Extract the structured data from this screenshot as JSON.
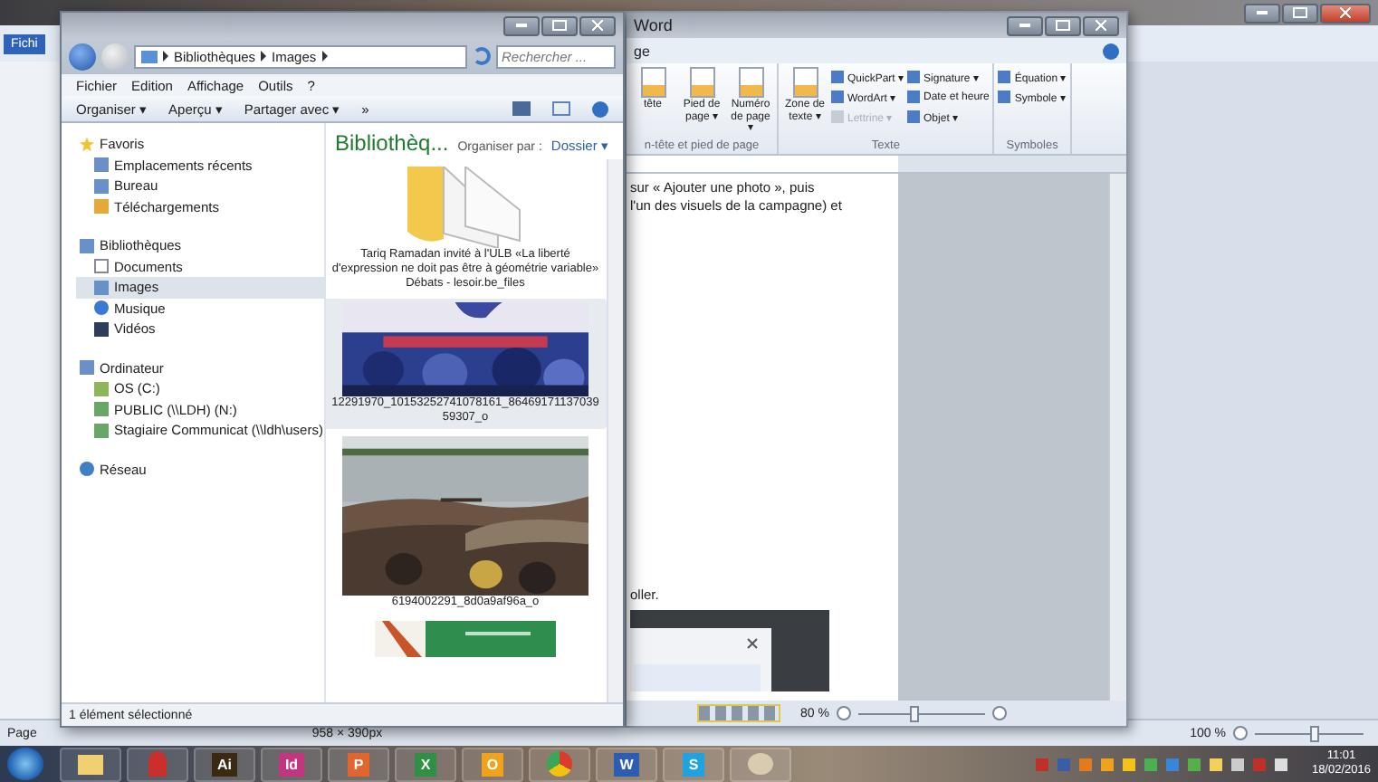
{
  "back_window": {
    "tab": "Fichi",
    "page_label": "Page",
    "size_label": "958 × 390px",
    "zoom": {
      "reading": "100 %",
      "level": 0.55
    }
  },
  "word_window": {
    "title": "Word",
    "tab_fragment": "ge",
    "groups": [
      {
        "label": "n-tête et pied de page",
        "large": [
          "tête",
          "Pied de page ▾",
          "Numéro de page ▾"
        ]
      },
      {
        "label": "Texte",
        "large": [
          "Zone de texte ▾"
        ],
        "small": [
          {
            "label": "QuickPart ▾",
            "disabled": false
          },
          {
            "label": "WordArt ▾",
            "disabled": false
          },
          {
            "label": "Lettrine ▾",
            "disabled": true
          },
          {
            "label": "Signature ▾",
            "disabled": false
          },
          {
            "label": "Date et heure",
            "disabled": false
          },
          {
            "label": "Objet ▾",
            "disabled": false
          }
        ]
      },
      {
        "label": "Symboles",
        "small": [
          {
            "label": "Équation ▾",
            "disabled": false
          },
          {
            "label": "Symbole ▾",
            "disabled": false
          }
        ]
      }
    ],
    "doc_lines": [
      "sur « Ajouter une photo », puis",
      "l'un des visuels de la campagne) et"
    ],
    "doc_fragment": "oller.",
    "zoom": {
      "reading": "80 %",
      "level": 0.45
    }
  },
  "explorer": {
    "address": [
      "Bibliothèques",
      "Images"
    ],
    "search": {
      "placeholder": "Rechercher ..."
    },
    "menu": [
      "Fichier",
      "Edition",
      "Affichage",
      "Outils",
      "?"
    ],
    "toolbar": [
      "Organiser ▾",
      "Aperçu ▾",
      "Partager avec ▾",
      "»"
    ],
    "nav": [
      {
        "label": "Favoris",
        "kind": "star",
        "selected": false,
        "children": [
          {
            "label": "Emplacements récents",
            "kind": "recent",
            "selected": false
          },
          {
            "label": "Bureau",
            "kind": "desktop",
            "selected": false
          },
          {
            "label": "Téléchargements",
            "kind": "download",
            "selected": false
          }
        ]
      },
      {
        "label": "Bibliothèques",
        "kind": "library",
        "selected": false,
        "children": [
          {
            "label": "Documents",
            "kind": "document",
            "selected": false
          },
          {
            "label": "Images",
            "selected": true
          },
          {
            "label": "Musique",
            "kind": "music",
            "selected": false
          },
          {
            "label": "Vidéos",
            "kind": "video",
            "selected": false
          }
        ]
      },
      {
        "label": "Ordinateur",
        "kind": "computer",
        "selected": false,
        "children": [
          {
            "label": "OS (C:)",
            "kind": "drive",
            "selected": false
          },
          {
            "label": "PUBLIC (\\\\LDH) (N:)",
            "kind": "network-drive",
            "selected": false
          },
          {
            "label": "Stagiaire Communicat (\\\\ldh\\users)",
            "kind": "network-drive",
            "selected": false
          }
        ]
      },
      {
        "label": "Réseau",
        "kind": "network",
        "selected": false
      }
    ],
    "content_title": "Bibliothèq...",
    "arrange_label": "Organiser par :",
    "arrange_value": "Dossier ▾",
    "items": [
      {
        "kind": "folder",
        "caption": "Tariq Ramadan invité à l'ULB «La liberté d'expression ne doit pas être à géométrie variable» Débats - lesoir.be_files",
        "selected": false
      },
      {
        "kind": "crowd-blue",
        "caption": "12291970_10153252741078161_8646917113703959307_o",
        "selected": true
      },
      {
        "kind": "riverbank",
        "caption": "6194002291_8d0a9af96a_o",
        "selected": false
      },
      {
        "kind": "green-poster",
        "selected": false
      }
    ],
    "status": "1 élément sélectionné"
  },
  "taskbar": {
    "apps": [
      {
        "kind": "folder"
      },
      {
        "kind": "figure"
      },
      {
        "kind": "letter",
        "glyph": "Ai",
        "color": "#3b2a12"
      },
      {
        "kind": "letter",
        "glyph": "Id",
        "color": "#c2367f"
      },
      {
        "kind": "letter",
        "glyph": "P",
        "color": "#e2652e"
      },
      {
        "kind": "letter",
        "glyph": "X",
        "color": "#2f8f45"
      },
      {
        "kind": "letter",
        "glyph": "O",
        "color": "#f0a21a"
      },
      {
        "kind": "chrome"
      },
      {
        "kind": "letter",
        "glyph": "W",
        "color": "#2b5eb3"
      },
      {
        "kind": "letter",
        "glyph": "S",
        "color": "#1fa3e0"
      },
      {
        "kind": "paint"
      }
    ],
    "time": "11:01",
    "date": "18/02/2016"
  }
}
